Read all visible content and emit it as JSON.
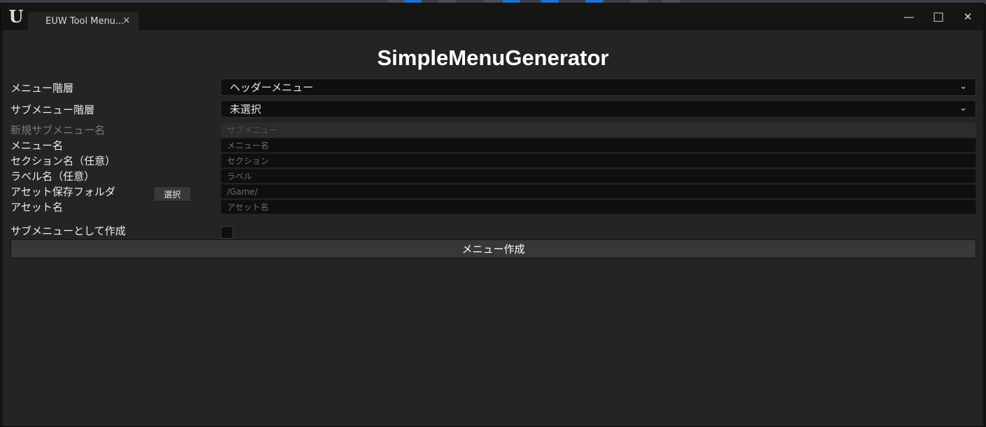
{
  "window": {
    "tab_title": "EUW Tool Menu...",
    "tab_close": "×",
    "minimize": "—",
    "maximize": "□",
    "close": "✕"
  },
  "main": {
    "heading": "SimpleMenuGenerator",
    "menu_level": {
      "label": "メニュー階層",
      "value": "ヘッダーメニュー"
    },
    "submenu_level": {
      "label": "サブメニュー階層",
      "value": "未選択"
    },
    "new_submenu_name": {
      "label": "新規サブメニュー名",
      "placeholder": "サブメニュー"
    },
    "menu_name": {
      "label": "メニュー名",
      "placeholder": "メニュー名"
    },
    "section_name": {
      "label": "セクション名（任意）",
      "placeholder": "セクション"
    },
    "label_name": {
      "label": "ラベル名（任意）",
      "placeholder": "ラベル"
    },
    "asset_folder": {
      "label": "アセット保存フォルダ",
      "button": "選択",
      "placeholder": "/Game/"
    },
    "asset_name": {
      "label": "アセット名",
      "placeholder": "アセット名"
    },
    "create_as_submenu": {
      "label": "サブメニューとして作成",
      "checked": false
    },
    "create_button": "メニュー作成"
  },
  "colors": {
    "window_bg": "#242424",
    "titlebar_bg": "#151515",
    "input_bg": "#0f0f0f",
    "button_bg": "#383838"
  }
}
